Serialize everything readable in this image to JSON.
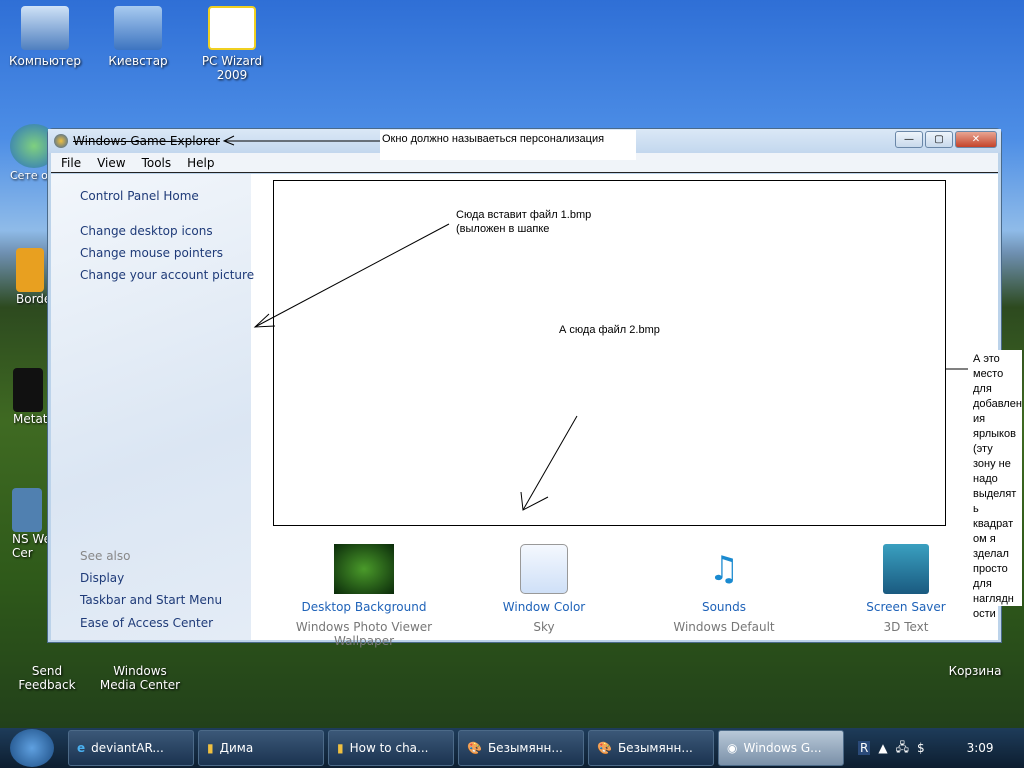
{
  "desktop": {
    "icons": [
      "Компьютер",
      "Киевстар",
      "PC Wizard 2009",
      "Сете окруж",
      "Borde",
      "Metat",
      "NS We Cer",
      "Send Feedback",
      "Windows Media Center",
      "Корзина"
    ]
  },
  "window": {
    "title": "Windows Game Explorer",
    "menu": [
      "File",
      "View",
      "Tools",
      "Help"
    ],
    "left": {
      "home": "Control Panel Home",
      "links": [
        "Change desktop icons",
        "Change mouse pointers",
        "Change your account picture"
      ],
      "see_also": "See also",
      "see_links": [
        "Display",
        "Taskbar and Start Menu",
        "Ease of Access Center"
      ]
    },
    "items": [
      {
        "label": "Desktop Background",
        "sub": "Windows Photo Viewer Wallpaper"
      },
      {
        "label": "Window Color",
        "sub": "Sky"
      },
      {
        "label": "Sounds",
        "sub": "Windows Default"
      },
      {
        "label": "Screen Saver",
        "sub": "3D Text"
      }
    ]
  },
  "annotations": {
    "title_note": "Окно должно называеться персонализация",
    "header_note_1": "Сюда вставит файл 1.bmp",
    "header_note_2": "(выложен в шапке",
    "main_note": "А сюда файл 2.bmp",
    "side_note": "А это место для добавлен ия ярлыков (эту зону не надо выделят ь квадрат ом я зделал просто для наглядн ости"
  },
  "taskbar": {
    "tasks": [
      "deviantAR...",
      "Дима",
      "How to cha...",
      "Безымянн...",
      "Безымянн...",
      "Windows G..."
    ],
    "tray_lang": "R",
    "clock": "3:09"
  }
}
